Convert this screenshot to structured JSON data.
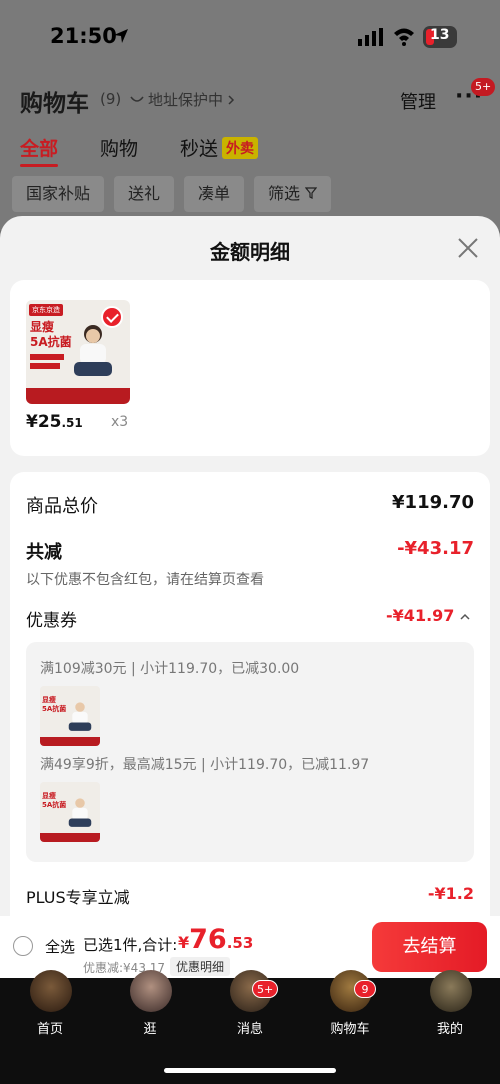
{
  "status": {
    "time": "21:50",
    "battery": "13"
  },
  "header": {
    "title": "购物车",
    "count": "(9)",
    "address": "地址保护中",
    "manage": "管理",
    "more_badge": "5+"
  },
  "tabs": [
    {
      "label": "全部"
    },
    {
      "label": "购物"
    },
    {
      "label": "秒送"
    }
  ],
  "waimai_badge": "外卖",
  "filters": [
    {
      "label": "国家补贴"
    },
    {
      "label": "送礼"
    },
    {
      "label": "凑单"
    },
    {
      "label": "筛选"
    }
  ],
  "sheet": {
    "title": "金额明细"
  },
  "product": {
    "store_label": "京东京造",
    "title_line1": "显瘦",
    "title_line2": "5A抗菌",
    "price_int": "¥25",
    "price_dec": ".51",
    "qty": "x3"
  },
  "breakdown": {
    "total_label": "商品总价",
    "total_value": "¥119.70",
    "reduce_label": "共减",
    "reduce_value": "-¥43.17",
    "note": "以下优惠不包含红包，请在结算页查看",
    "coupon_label": "优惠券",
    "coupon_value": "-¥41.97",
    "rule1": "满109减30元 | 小计119.70，已减30.00",
    "rule2": "满49享9折，最高减15元 | 小计119.70，已减11.97",
    "plus_label": "PLUS专享立减",
    "plus_value": "-¥1.2"
  },
  "bottom": {
    "select_all": "全选",
    "selected": "已选1件,合计:",
    "currency": "¥",
    "total_int": "76",
    "total_dec": ".53",
    "saved": "优惠减:¥43.17",
    "detail": "优惠明细",
    "checkout": "去结算"
  },
  "nav": [
    {
      "label": "首页"
    },
    {
      "label": "逛"
    },
    {
      "label": "消息",
      "badge": "5+"
    },
    {
      "label": "购物车",
      "badge": "9"
    },
    {
      "label": "我的"
    }
  ],
  "colors": {
    "accent": "#e8212b",
    "dim_overlay": "#7a7a7a"
  }
}
